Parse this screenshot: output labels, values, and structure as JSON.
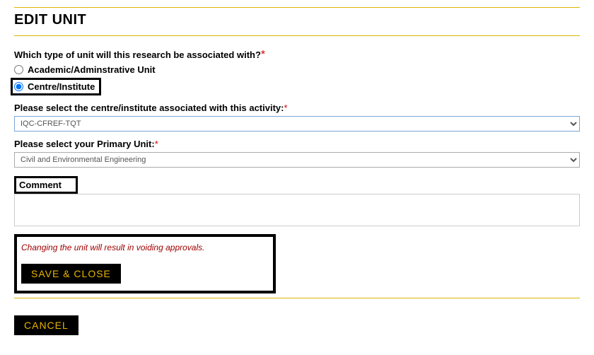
{
  "heading": "EDIT UNIT",
  "questions": {
    "unit_type": {
      "label": "Which type of unit will this research be associated with?",
      "required": "*",
      "options": [
        {
          "label": "Academic/Adminstrative Unit",
          "selected": false
        },
        {
          "label": "Centre/Institute",
          "selected": true
        }
      ]
    },
    "centre_institute": {
      "label": "Please select the centre/institute associated with this activity:",
      "required": "*",
      "value": "IQC-CFREF-TQT"
    },
    "primary_unit": {
      "label": "Please select your Primary Unit:",
      "required": "*",
      "value": "Civil and Environmental Engineering"
    },
    "comment": {
      "label": "Comment",
      "value": ""
    }
  },
  "warning": "Changing the unit will result in voiding approvals.",
  "buttons": {
    "save_close": "SAVE & CLOSE",
    "cancel": "CANCEL"
  }
}
